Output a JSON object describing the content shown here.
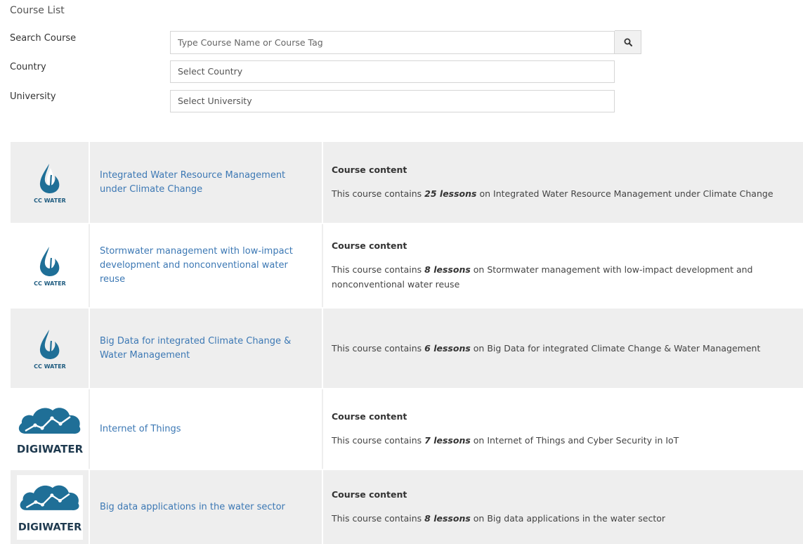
{
  "page": {
    "title": "Course List"
  },
  "filters": {
    "search_label": "Search Course",
    "search_placeholder": "Type Course Name or Course Tag",
    "country_label": "Country",
    "country_value": "Select Country",
    "university_label": "University",
    "university_value": "Select University"
  },
  "icons": {
    "search": "search-icon",
    "cc_water_logo": "cc-water-logo",
    "digiwater_logo": "digiwater-logo"
  },
  "colors": {
    "link": "#3c78b4",
    "row_shade": "#eeeeee",
    "logo_blue": "#1f6f97"
  },
  "courses": [
    {
      "logo": "cc-water",
      "logo_text": "CC WATER",
      "title": "Integrated Water Resource Management under Climate Change",
      "heading": "Course content",
      "text_pre": "This course contains ",
      "lessons": "25 lessons",
      "text_post": " on Integrated Water Resource Management under Climate Change"
    },
    {
      "logo": "cc-water",
      "logo_text": "CC WATER",
      "title": "Stormwater management with low-impact development and nonconventional water reuse",
      "heading": "Course content",
      "text_pre": "This course contains ",
      "lessons": "8 lessons",
      "text_post": " on Stormwater management with low-impact development and nonconventional water reuse"
    },
    {
      "logo": "cc-water",
      "logo_text": "CC WATER",
      "title": "Big Data for integrated Climate Change & Water Management",
      "heading": "",
      "text_pre": "This course contains ",
      "lessons": "6 lessons",
      "text_post": " on Big Data for integrated Climate Change & Water Management"
    },
    {
      "logo": "digiwater",
      "logo_text": "DIGIWATER",
      "title": "Internet of Things",
      "heading": "Course content",
      "text_pre": "This course contains ",
      "lessons": "7 lessons",
      "text_post": " on Internet of Things and Cyber Security in IoT"
    },
    {
      "logo": "digiwater",
      "logo_text": "DIGIWATER",
      "title": "Big data applications in the water sector",
      "heading": "Course content",
      "text_pre": "This course contains ",
      "lessons": "8 lessons",
      "text_post": " on Big data applications in the water sector"
    }
  ]
}
